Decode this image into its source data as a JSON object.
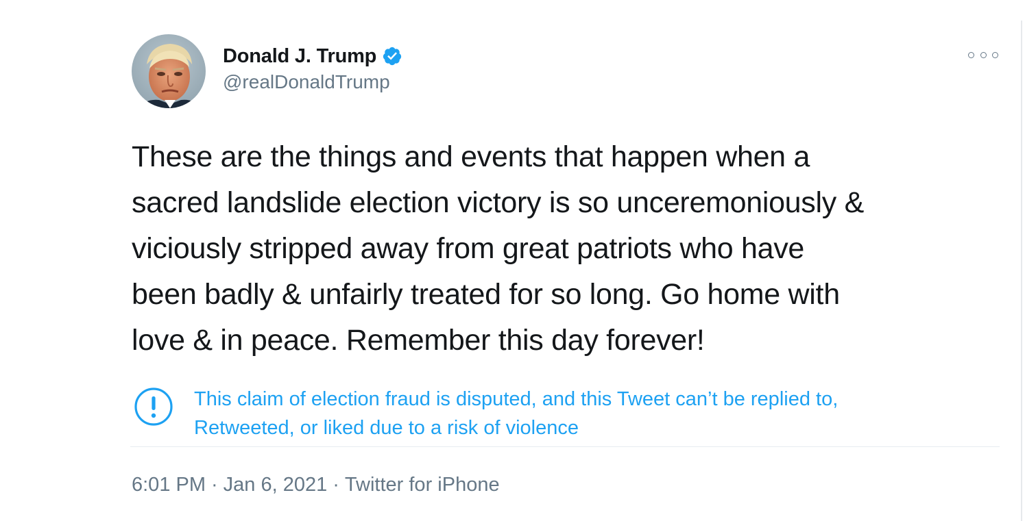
{
  "tweet": {
    "author": {
      "display_name": "Donald J. Trump",
      "handle": "@realDonaldTrump",
      "verified": true,
      "avatar_icon": "profile-photo",
      "verified_icon": "verified-badge-icon",
      "verified_color": "#1da1f2"
    },
    "more_icon": "more-options-icon",
    "text_lines": [
      "These are the things and events that happen when a",
      "sacred landslide election victory is so unceremoniously &",
      "viciously stripped away from great patriots who have",
      "been badly & unfairly treated for so long. Go home with",
      "love & in peace. Remember this day forever!"
    ],
    "notice": {
      "icon": "exclamation-circle-icon",
      "lines": [
        "This claim of election fraud is disputed, and this Tweet can’t be replied to,",
        "Retweeted, or liked due to a risk of violence"
      ],
      "color": "#1da1f2"
    },
    "meta": {
      "time": "6:01 PM",
      "separator": "·",
      "date": "Jan 6, 2021",
      "source": "Twitter for iPhone"
    }
  }
}
